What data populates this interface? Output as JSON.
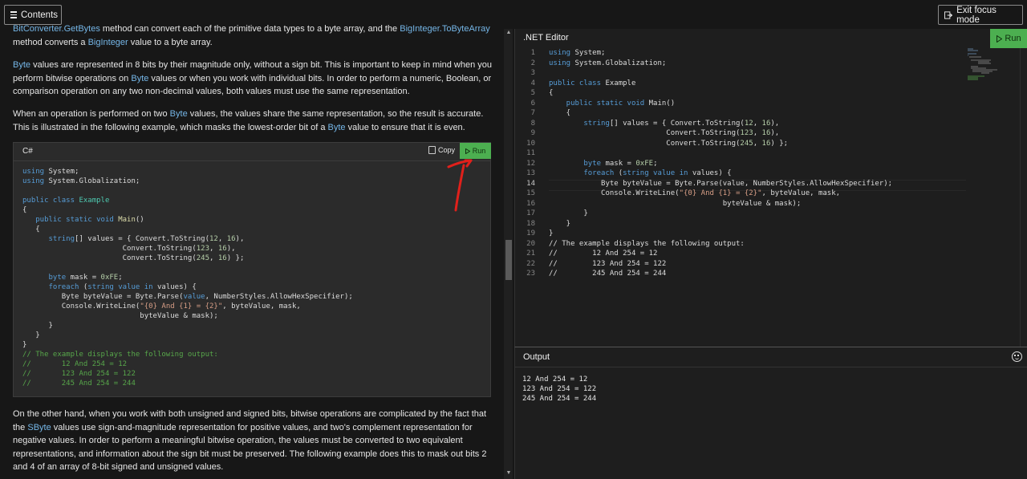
{
  "top": {
    "contents_label": "Contents",
    "exit_label": "Exit focus mode"
  },
  "article": {
    "p0": {
      "a": "BitConverter.GetBytes",
      "b": " method can convert each of the primitive data types to a byte array, and the ",
      "c": "BigInteger.ToByteArray",
      "d": "method converts a ",
      "e": "BigInteger",
      "f": " value to a byte array."
    },
    "p1": {
      "a": "Byte",
      "b": " values are represented in 8 bits by their magnitude only, without a sign bit. This is important to keep in mind when you perform bitwise operations on ",
      "c": "Byte",
      "d": " values or when you work with individual bits. In order to perform a numeric, Boolean, or comparison operation on any two non-decimal values, both values must use the same representation."
    },
    "p2": {
      "a": "When an operation is performed on two ",
      "b": "Byte",
      "c": " values, the values share the same representation, so the result is accurate. This is illustrated in the following example, which masks the lowest-order bit of a ",
      "d": "Byte",
      "e": " value to ensure that it is even."
    },
    "p3": {
      "a": "On the other hand, when you work with both unsigned and signed bits, bitwise operations are complicated by the fact that the ",
      "b": "SByte",
      "c": " values use sign-and-magnitude representation for positive values, and two's complement representation for negative values. In order to perform a meaningful bitwise operation, the values must be converted to two equivalent representations, and information about the sign bit must be preserved. The following example does this to mask out bits 2 and 4 of an array of 8-bit signed and unsigned values."
    }
  },
  "codeblock": {
    "lang": "C#",
    "copy_label": "Copy",
    "run_label": "Run",
    "code": {
      "l1a": "using",
      "l1b": " System;",
      "l2a": "using",
      "l2b": " System.Globalization;",
      "l4a": "public class",
      "l4b": " Example",
      "l5": "{",
      "l6a": "   public static void",
      "l6b": " Main",
      "l6c": "()",
      "l7": "   {",
      "l8a": "      string",
      "l8b": "[] values = { Convert.ToString(",
      "l8c": "12",
      "l8d": ", ",
      "l8e": "16",
      "l8f": "),",
      "l9a": "                       Convert.ToString(",
      "l9b": "123",
      "l9c": ", ",
      "l9d": "16",
      "l9e": "),",
      "l10a": "                       Convert.ToString(",
      "l10b": "245",
      "l10c": ", ",
      "l10d": "16",
      "l10e": ") };",
      "l12a": "      byte",
      "l12b": " mask = ",
      "l12c": "0xFE",
      "l12d": ";",
      "l13a": "      foreach",
      "l13b": " (",
      "l13c": "string value in",
      "l13d": " values) {",
      "l14": "         Byte byteValue = Byte.Parse(",
      "l14b": "value",
      "l14c": ", NumberStyles.AllowHexSpecifier);",
      "l15a": "         Console.WriteLine(",
      "l15b": "\"{0} And {1} = {2}\"",
      "l15c": ", byteValue, mask,",
      "l16": "                           byteValue & mask);",
      "l17": "      }",
      "l18": "   }",
      "l19": "}",
      "l20": "// The example displays the following output:",
      "l21": "//       12 And 254 = 12",
      "l22": "//       123 And 254 = 122",
      "l23": "//       245 And 254 = 244"
    }
  },
  "editor": {
    "title": ".NET Editor",
    "run_label": "Run",
    "line_numbers": [
      "1",
      "2",
      "3",
      "4",
      "5",
      "6",
      "7",
      "8",
      "9",
      "10",
      "11",
      "12",
      "13",
      "14",
      "15",
      "16",
      "17",
      "18",
      "19",
      "20",
      "21",
      "22",
      "23"
    ],
    "current_line": "14",
    "code": {
      "e1a": "using",
      "e1b": " System;",
      "e2a": "using",
      "e2b": " System.Globalization;",
      "e4a": "public class",
      "e4b": " Example",
      "e5": "{",
      "e6a": "    public static void",
      "e6b": " Main()",
      "e7": "    {",
      "e8a": "        string",
      "e8b": "[] values = { Convert.ToString(",
      "e8c": "12",
      "e8d": ", ",
      "e8e": "16",
      "e8f": "),",
      "e9a": "                           Convert.ToString(",
      "e9b": "123",
      "e9c": ", ",
      "e9d": "16",
      "e9e": "),",
      "e10a": "                           Convert.ToString(",
      "e10b": "245",
      "e10c": ", ",
      "e10d": "16",
      "e10e": ") };",
      "e12a": "        byte",
      "e12b": " mask = ",
      "e12c": "0xFE",
      "e12d": ";",
      "e13a": "        foreach",
      "e13b": " (",
      "e13c": "string value in",
      "e13d": " values) {",
      "e14": "            Byte byteValue = Byte.Parse(value, NumberStyles.AllowHexSpecifier);",
      "e15a": "            Console.WriteLine(",
      "e15b": "\"{0} And {1} = {2}\"",
      "e15c": ", byteValue, mask,",
      "e16": "                                        byteValue & mask);",
      "e17": "        }",
      "e18": "    }",
      "e19": "}",
      "e20": "// The example displays the following output:",
      "e21": "//        12 And 254 = 12",
      "e22": "//        123 And 254 = 122",
      "e23": "//        245 And 254 = 244"
    }
  },
  "output": {
    "title": "Output",
    "lines": [
      "12 And 254 = 12",
      "123 And 254 = 122",
      "245 And 254 = 244"
    ]
  },
  "colors": {
    "run_green": "#4caf50",
    "link_blue": "#75b6e7",
    "annotation_red": "#e0201b"
  }
}
